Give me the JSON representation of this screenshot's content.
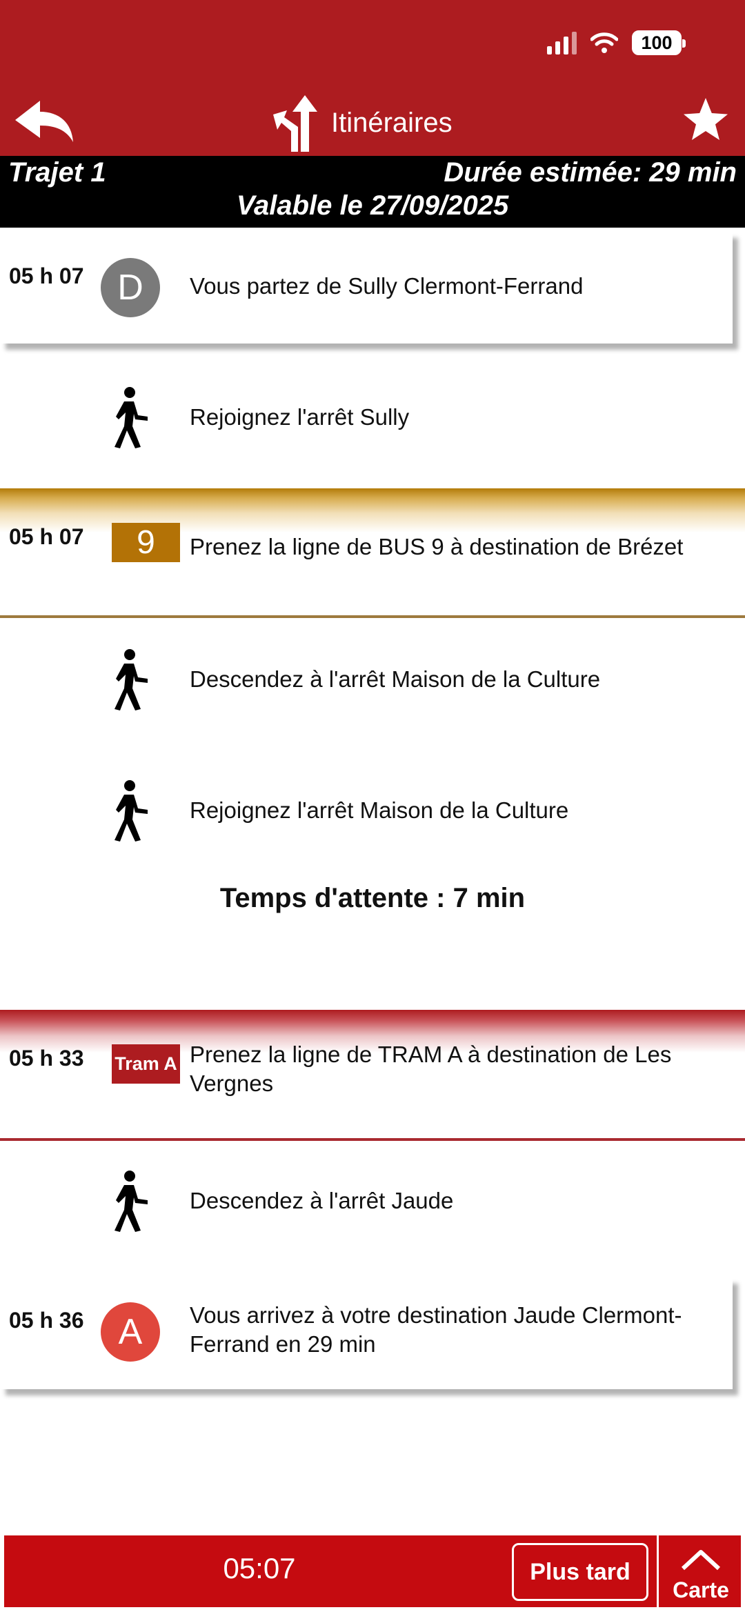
{
  "status": {
    "battery": "100"
  },
  "header": {
    "title": "Itinéraires"
  },
  "trip": {
    "name": "Trajet 1",
    "duration": "Durée estimée: 29 min",
    "validity": "Valable le 27/09/2025"
  },
  "steps": [
    {
      "time": "05 h 07",
      "badge": "D",
      "text": "Vous partez de Sully Clermont-Ferrand"
    },
    {
      "text": "Rejoignez l'arrêt Sully"
    },
    {
      "time": "05 h 07",
      "badge": "9",
      "badge_color": "#b37206",
      "text": "Prenez la ligne de BUS 9 à destination de Brézet"
    },
    {
      "text": "Descendez à l'arrêt Maison de la Culture"
    },
    {
      "text": "Rejoignez l'arrêt Maison de la Culture"
    },
    {
      "time": "05 h 33",
      "badge": "Tram A",
      "badge_color": "#ad1c20",
      "text": "Prenez la ligne de TRAM A à destination de Les Vergnes"
    },
    {
      "text": "Descendez à l'arrêt Jaude"
    },
    {
      "time": "05 h 36",
      "badge": "A",
      "text": "Vous arrivez à votre destination Jaude Clermont-Ferrand en 29 min"
    }
  ],
  "wait": "Temps d'attente : 7 min",
  "footer": {
    "time": "05:07",
    "later_label": "Plus tard",
    "map_label": "Carte"
  },
  "colors": {
    "brand": "#ad1c20",
    "bus_line": "#b37206",
    "tram_line": "#ad1c20",
    "departure": "#7a7a7a",
    "arrival": "#e0473c"
  },
  "icons": [
    "back-arrow-icon",
    "directions-icon",
    "star-icon",
    "pedestrian-icon",
    "home-icon"
  ]
}
